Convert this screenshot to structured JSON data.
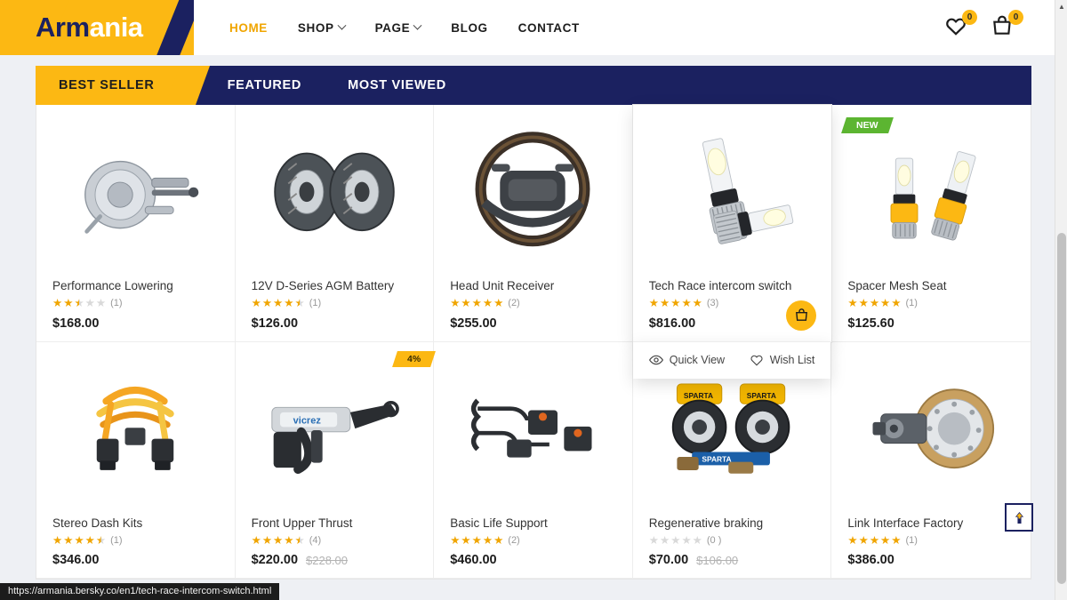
{
  "header": {
    "logo": {
      "part1": "Arm",
      "part2": "ania"
    },
    "nav": [
      {
        "label": "HOME",
        "active": true,
        "caret": false,
        "name": "nav-home"
      },
      {
        "label": "SHOP",
        "active": false,
        "caret": true,
        "name": "nav-shop"
      },
      {
        "label": "PAGE",
        "active": false,
        "caret": true,
        "name": "nav-page"
      },
      {
        "label": "BLOG",
        "active": false,
        "caret": false,
        "name": "nav-blog"
      },
      {
        "label": "CONTACT",
        "active": false,
        "caret": false,
        "name": "nav-contact"
      }
    ],
    "wishlist_count": "0",
    "cart_count": "0"
  },
  "tabs": [
    {
      "label": "BEST SELLER",
      "active": true
    },
    {
      "label": "FEATURED",
      "active": false
    },
    {
      "label": "MOST VIEWED",
      "active": false
    }
  ],
  "hover_actions": {
    "quick_view": "Quick View",
    "wish_list": "Wish List"
  },
  "products": [
    {
      "name": "Performance Lowering",
      "rating": 2.5,
      "reviews": "(1)",
      "price": "$168.00",
      "old_price": "",
      "badge": "",
      "image": "brake-booster"
    },
    {
      "name": "12V D-Series AGM Battery",
      "rating": 4.5,
      "reviews": "(1)",
      "price": "$126.00",
      "old_price": "",
      "badge": "",
      "image": "brake-rotors"
    },
    {
      "name": "Head Unit Receiver",
      "rating": 5,
      "reviews": "(2)",
      "price": "$255.00",
      "old_price": "",
      "badge": "",
      "image": "steering-wheel"
    },
    {
      "name": "Tech Race intercom switch",
      "rating": 5,
      "reviews": "(3)",
      "price": "$816.00",
      "old_price": "",
      "badge": "",
      "image": "led-bulbs",
      "hovered": true
    },
    {
      "name": "Spacer Mesh Seat",
      "rating": 5,
      "reviews": "(1)",
      "price": "$125.60",
      "old_price": "",
      "badge": "NEW",
      "badge_type": "new",
      "image": "led-bulbs2"
    },
    {
      "name": "Stereo Dash Kits",
      "rating": 4.5,
      "reviews": "(1)",
      "price": "$346.00",
      "old_price": "",
      "badge": "",
      "image": "clock-spring"
    },
    {
      "name": "Front Upper Thrust",
      "rating": 4.5,
      "reviews": "(4)",
      "price": "$220.00",
      "old_price": "$228.00",
      "badge": "4%",
      "badge_type": "discount",
      "image": "caulk-gun"
    },
    {
      "name": "Basic Life Support",
      "rating": 5,
      "reviews": "(2)",
      "price": "$460.00",
      "old_price": "",
      "badge": "",
      "image": "sensor-kit"
    },
    {
      "name": "Regenerative braking",
      "rating": 0,
      "reviews": "(0 )",
      "price": "$70.00",
      "old_price": "$106.00",
      "badge": "",
      "image": "big-brake-kit"
    },
    {
      "name": "Link Interface Factory",
      "rating": 5,
      "reviews": "(1)",
      "price": "$386.00",
      "old_price": "",
      "badge": "",
      "image": "hub-rotor"
    }
  ],
  "status_bar": {
    "url": "https://armania.bersky.co/en1/tech-race-intercom-switch.html"
  },
  "colors": {
    "brand_yellow": "#fcb813",
    "brand_navy": "#1b2160",
    "new_green": "#5cb531",
    "star_gold": "#f0a500"
  }
}
